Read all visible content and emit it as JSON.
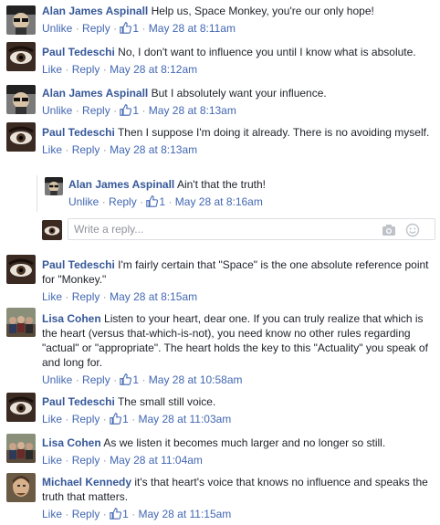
{
  "meta_labels": {
    "like": "Like",
    "unlike": "Unlike",
    "reply": "Reply",
    "dot": "·"
  },
  "comments": [
    {
      "author": "Alan James Aspinall",
      "text": "Help us, Space Monkey, you're our only hope!",
      "action": "Unlike",
      "likes": "1",
      "time": "May 28 at 8:11am",
      "avatar": "alan-avatar"
    },
    {
      "author": "Paul Tedeschi",
      "text": "No, I don't want to influence you until I know what is absolute.",
      "action": "Like",
      "likes": "",
      "time": "May 28 at 8:12am",
      "avatar": "paul-avatar"
    },
    {
      "author": "Alan James Aspinall",
      "text": "But I absolutely want your influence.",
      "action": "Unlike",
      "likes": "1",
      "time": "May 28 at 8:13am",
      "avatar": "alan-avatar"
    },
    {
      "author": "Paul Tedeschi",
      "text": "Then I suppose I'm doing it already. There is no avoiding myself.",
      "action": "Like",
      "likes": "",
      "time": "May 28 at 8:13am",
      "avatar": "paul-avatar"
    },
    {
      "author": "Paul Tedeschi",
      "text": "I'm fairly certain that \"Space\" is the one absolute reference point for \"Monkey.\"",
      "action": "Like",
      "likes": "",
      "time": "May 28 at 8:15am",
      "avatar": "paul-avatar"
    },
    {
      "author": "Lisa Cohen",
      "text": "Listen to your heart, dear one. If you can truly realize that which is the heart (versus that-which-is-not), you need know no other rules regarding \"actual\" or \"appropriate\". The heart holds the key to this \"Actuality\" you speak of and long for.",
      "action": "Unlike",
      "likes": "1",
      "time": "May 28 at 10:58am",
      "avatar": "lisa-avatar"
    },
    {
      "author": "Paul Tedeschi",
      "text": "The small still voice.",
      "action": "Like",
      "likes": "1",
      "time": "May 28 at 11:03am",
      "avatar": "paul-avatar"
    },
    {
      "author": "Lisa Cohen",
      "text": "As we listen it becomes much larger and no longer so still.",
      "action": "Like",
      "likes": "",
      "time": "May 28 at 11:04am",
      "avatar": "lisa-avatar"
    },
    {
      "author": "Michael Kennedy",
      "text": "it's that heart's voice that knows no influence and speaks the truth that matters.",
      "action": "Like",
      "likes": "1",
      "time": "May 28 at 11:15am",
      "avatar": "michael-avatar"
    }
  ],
  "nested_reply": {
    "author": "Alan James Aspinall",
    "text": "Ain't that the truth!",
    "action": "Unlike",
    "likes": "1",
    "time": "May 28 at 8:16am",
    "avatar": "alan-avatar"
  },
  "reply_input": {
    "placeholder": "Write a reply..."
  },
  "colors": {
    "author": "#365899",
    "link": "#4267b2",
    "meta": "#90949c",
    "text": "#1d2129",
    "border": "#dddfe2"
  }
}
